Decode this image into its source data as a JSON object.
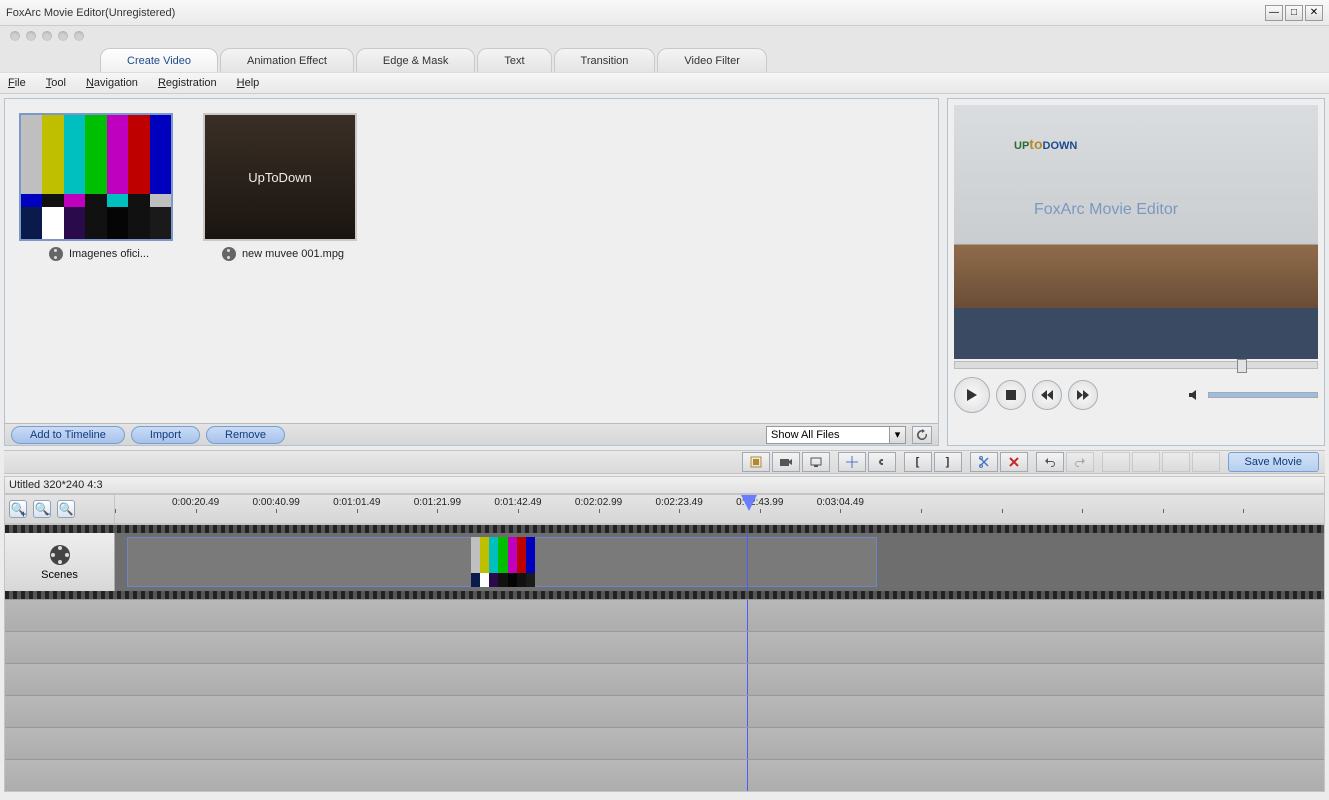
{
  "window": {
    "title": "FoxArc Movie Editor(Unregistered)"
  },
  "tabs": [
    "Create Video",
    "Animation Effect",
    "Edge & Mask",
    "Text",
    "Transition",
    "Video Filter"
  ],
  "activeTab": 0,
  "menu": {
    "file": "File",
    "tool": "Tool",
    "navigation": "Navigation",
    "registration": "Registration",
    "help": "Help"
  },
  "media": {
    "items": [
      {
        "name": "Imagenes ofici...",
        "kind": "smpte"
      },
      {
        "name": "new muvee 001.mpg",
        "kind": "uptodown"
      }
    ],
    "selectedIndex": 0,
    "buttons": {
      "add": "Add to Timeline",
      "import": "Import",
      "remove": "Remove"
    },
    "filter": "Show All Files"
  },
  "preview": {
    "logo_up": "UP",
    "logo_to": "to",
    "logo_down": "DOWN",
    "watermark": "FoxArc Movie Editor"
  },
  "toolbar2": {
    "save": "Save Movie",
    "icons": [
      "film",
      "camera",
      "monitor",
      "snap",
      "link",
      "bracket-left",
      "bracket-right",
      "cut",
      "delete",
      "undo",
      "redo",
      "a",
      "b",
      "c",
      "d"
    ]
  },
  "projectTitle": "Utitled 320*240 4:3",
  "ruler": [
    "0:00:20.49",
    "0:00:40.99",
    "0:01:01.49",
    "0:01:21.99",
    "0:01:42.49",
    "0:02:02.99",
    "0:02:23.49",
    "0:02:43.99",
    "0:03:04.49"
  ],
  "trackLabel": "Scenes",
  "thumbText": "UpToDown"
}
